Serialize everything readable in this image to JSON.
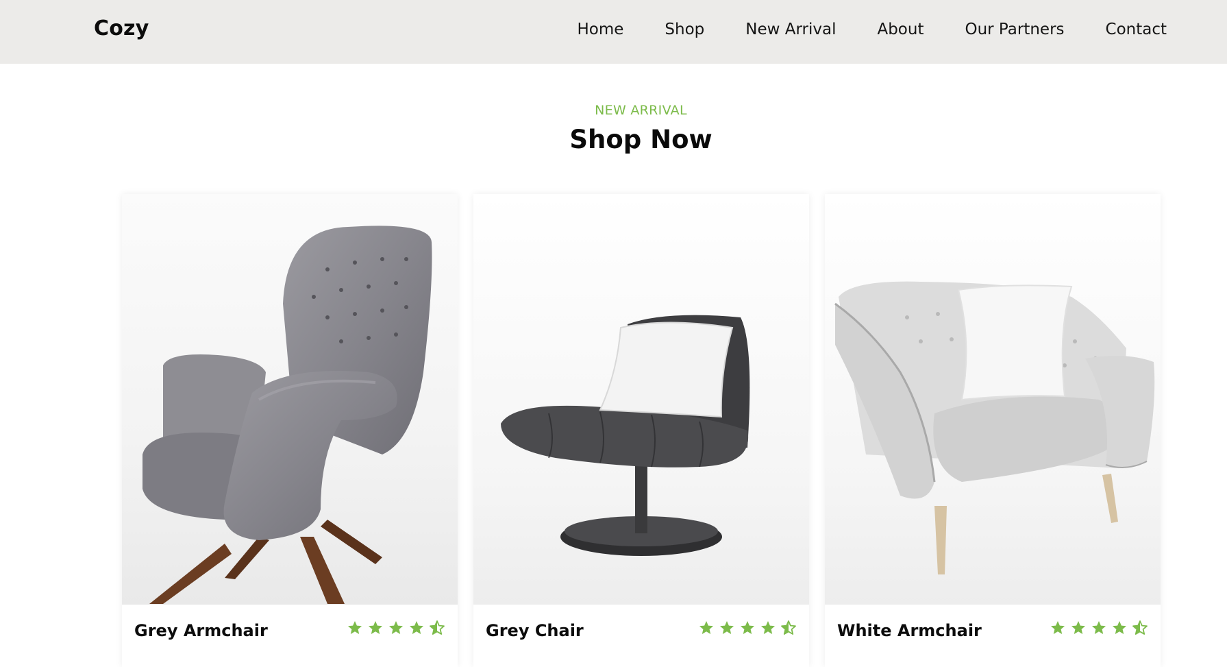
{
  "header": {
    "logo": "Cozy",
    "nav": [
      "Home",
      "Shop",
      "New Arrival",
      "About",
      "Our Partners",
      "Contact"
    ]
  },
  "section": {
    "eyebrow": "NEW ARRIVAL",
    "title": "Shop Now"
  },
  "products": [
    {
      "name": "Grey Armchair",
      "rating": 4.5
    },
    {
      "name": "Grey Chair",
      "rating": 4.5
    },
    {
      "name": "White Armchair",
      "rating": 4.5
    }
  ],
  "colors": {
    "accent": "#7cbb4a",
    "header_bg": "#ecebe9"
  },
  "icons": {
    "star_full": "star-icon",
    "star_half": "half-star-icon"
  }
}
